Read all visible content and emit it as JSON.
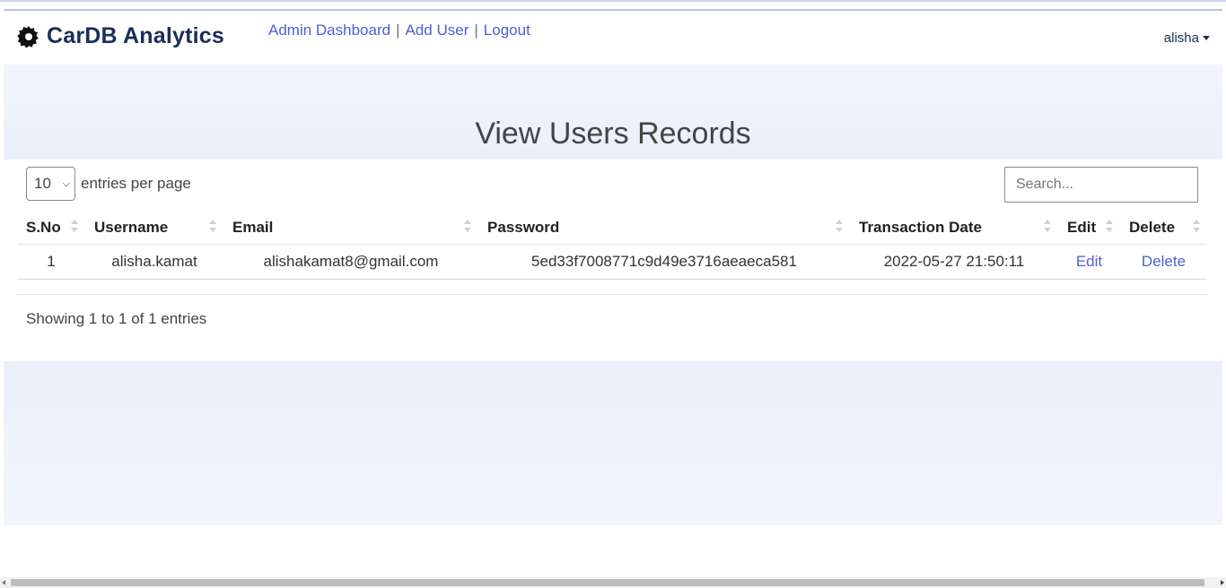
{
  "navbar": {
    "brand": "CarDB Analytics",
    "brand_icon": "gear-icon",
    "links": [
      "Admin Dashboard",
      "Add User",
      "Logout"
    ],
    "separator": "|",
    "user": "alisha"
  },
  "hero": {
    "title": "View Users Records"
  },
  "table_controls": {
    "per_page_value": "10",
    "per_page_label": "entries per page",
    "search_placeholder": "Search..."
  },
  "table": {
    "columns": [
      "S.No",
      "Username",
      "Email",
      "Password",
      "Transaction Date",
      "Edit",
      "Delete"
    ],
    "rows": [
      {
        "sno": "1",
        "username": "alisha.kamat",
        "email": "alishakamat8@gmail.com",
        "password": "5ed33f7008771c9d49e3716aeaeca581",
        "date": "2022-05-27 21:50:11",
        "edit": "Edit",
        "delete": "Delete"
      }
    ]
  },
  "info": "Showing 1 to 1 of 1 entries",
  "colors": {
    "brand": "#1a2e5c",
    "link": "#4b5fd6",
    "hero_bg": "#eef2fb"
  }
}
